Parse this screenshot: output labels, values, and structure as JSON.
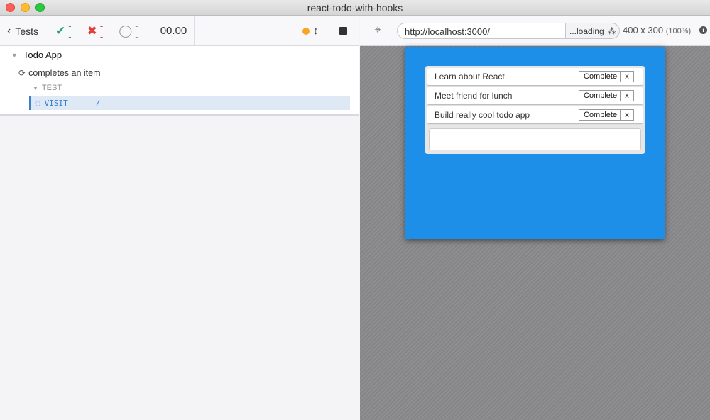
{
  "window": {
    "title": "react-todo-with-hooks"
  },
  "reporter": {
    "tests_label": "Tests",
    "stats": {
      "passed": "--",
      "failed": "--",
      "pending": "--"
    },
    "duration": "00.00",
    "suite": {
      "title": "Todo App"
    },
    "test": {
      "title": "completes an item"
    },
    "section_label": "TEST",
    "command": {
      "name": "VISIT",
      "arg": "/"
    }
  },
  "aut": {
    "url": "http://localhost:3000/",
    "loading_label": "...loading",
    "viewport": "400 x 300",
    "scale": "(100%)"
  },
  "todos": [
    {
      "text": "Learn about React",
      "complete_label": "Complete",
      "remove_label": "x"
    },
    {
      "text": "Meet friend for lunch",
      "complete_label": "Complete",
      "remove_label": "x"
    },
    {
      "text": "Build really cool todo app",
      "complete_label": "Complete",
      "remove_label": "x"
    }
  ],
  "colors": {
    "pass": "#20a36a",
    "fail": "#e0403b",
    "app_background": "#1e8fe8",
    "running_dot": "#f6a623"
  },
  "icons": [
    "chevron-left-icon",
    "check-icon",
    "cross-icon",
    "pending-circle-icon",
    "refresh-icon",
    "spinner-icon",
    "crosshair-icon",
    "info-icon",
    "stop-icon",
    "resize-arrows-icon"
  ]
}
